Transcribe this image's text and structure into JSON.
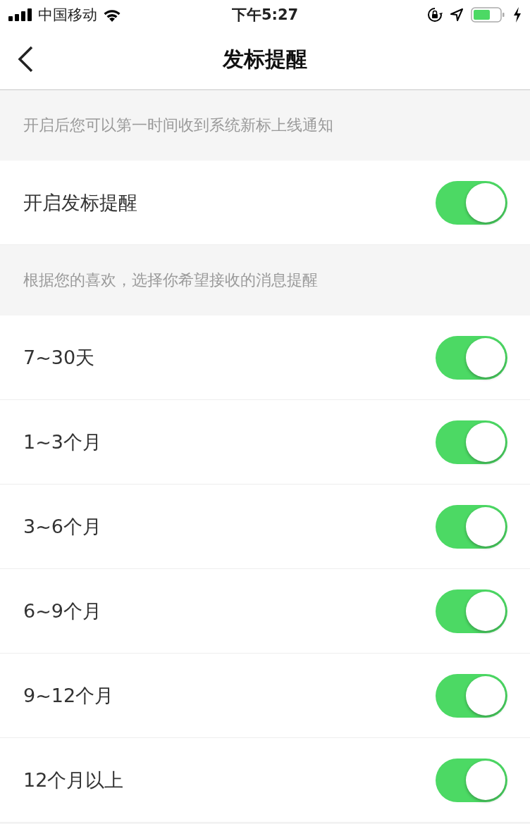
{
  "status_bar": {
    "carrier": "中国移动",
    "time": "下午5:27"
  },
  "nav_bar": {
    "title": "发标提醒"
  },
  "items": [
    {
      "kind": "note",
      "text": "开启后您可以第一时间收到系统新标上线通知"
    },
    {
      "kind": "toggle",
      "label": "开启发标提醒",
      "on": true
    },
    {
      "kind": "note",
      "text": "根据您的喜欢，选择你希望接收的消息提醒"
    },
    {
      "kind": "toggle",
      "label": "7~30天",
      "on": true
    },
    {
      "kind": "toggle",
      "label": "1~3个月",
      "on": true
    },
    {
      "kind": "toggle",
      "label": "3~6个月",
      "on": true
    },
    {
      "kind": "toggle",
      "label": "6~9个月",
      "on": true
    },
    {
      "kind": "toggle",
      "label": "9~12个月",
      "on": true
    },
    {
      "kind": "toggle",
      "label": "12个月以上",
      "on": true
    }
  ]
}
